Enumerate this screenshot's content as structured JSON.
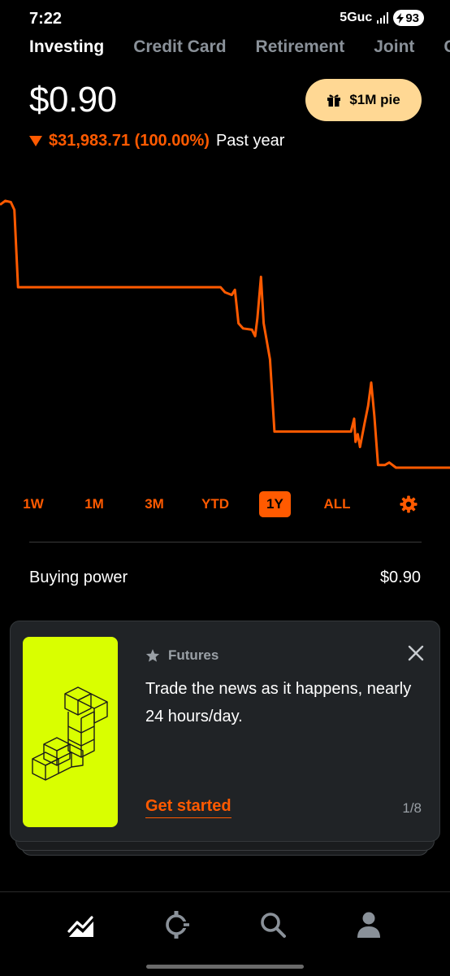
{
  "status_bar": {
    "time": "7:22",
    "network": "5Guc",
    "battery": "93"
  },
  "tabs": [
    {
      "label": "Investing",
      "active": true
    },
    {
      "label": "Credit Card",
      "active": false
    },
    {
      "label": "Retirement",
      "active": false
    },
    {
      "label": "Joint",
      "active": false
    },
    {
      "label": "C",
      "active": false
    }
  ],
  "portfolio": {
    "balance": "$0.90",
    "change": "$31,983.71 (100.00%)",
    "period": "Past year",
    "trend": "down"
  },
  "pie_button": {
    "label": "$1M pie",
    "icon": "gift-icon"
  },
  "chart_data": {
    "type": "line",
    "color": "#ff5a00",
    "y_min": 0.9,
    "y_start": 31984.61,
    "x_range": [
      "start of past year",
      "now"
    ],
    "points": [
      [
        0.0,
        1.02
      ],
      [
        0.012,
        1.035
      ],
      [
        0.024,
        1.03
      ],
      [
        0.032,
        1.0
      ],
      [
        0.04,
        0.7
      ],
      [
        0.49,
        0.7
      ],
      [
        0.5,
        0.68
      ],
      [
        0.515,
        0.67
      ],
      [
        0.522,
        0.69
      ],
      [
        0.53,
        0.56
      ],
      [
        0.54,
        0.54
      ],
      [
        0.56,
        0.535
      ],
      [
        0.567,
        0.51
      ],
      [
        0.572,
        0.58
      ],
      [
        0.58,
        0.74
      ],
      [
        0.586,
        0.56
      ],
      [
        0.6,
        0.42
      ],
      [
        0.61,
        0.14
      ],
      [
        0.78,
        0.14
      ],
      [
        0.787,
        0.19
      ],
      [
        0.79,
        0.1
      ],
      [
        0.795,
        0.13
      ],
      [
        0.8,
        0.08
      ],
      [
        0.81,
        0.17
      ],
      [
        0.818,
        0.24
      ],
      [
        0.825,
        0.33
      ],
      [
        0.832,
        0.2
      ],
      [
        0.84,
        0.01
      ],
      [
        0.855,
        0.01
      ],
      [
        0.865,
        0.02
      ],
      [
        0.88,
        0.0
      ],
      [
        1.0,
        0.0
      ]
    ]
  },
  "ranges": {
    "options": [
      "1W",
      "1M",
      "3M",
      "YTD",
      "1Y",
      "ALL"
    ],
    "selected": "1Y",
    "settings_icon": "gear-icon"
  },
  "buying_power": {
    "label": "Buying power",
    "value": "$0.90"
  },
  "promo_card": {
    "tag": "Futures",
    "tag_icon": "star-icon",
    "text": "Trade the news as it happens, nearly 24 hours/day.",
    "cta": "Get started",
    "pager": "1/8",
    "image_color": "#d9ff00"
  },
  "bottom_nav": [
    {
      "name": "investing",
      "icon": "chart-icon",
      "active": true
    },
    {
      "name": "crypto",
      "icon": "crypto-icon",
      "active": false
    },
    {
      "name": "search",
      "icon": "search-icon",
      "active": false
    },
    {
      "name": "account",
      "icon": "account-icon",
      "active": false
    }
  ]
}
